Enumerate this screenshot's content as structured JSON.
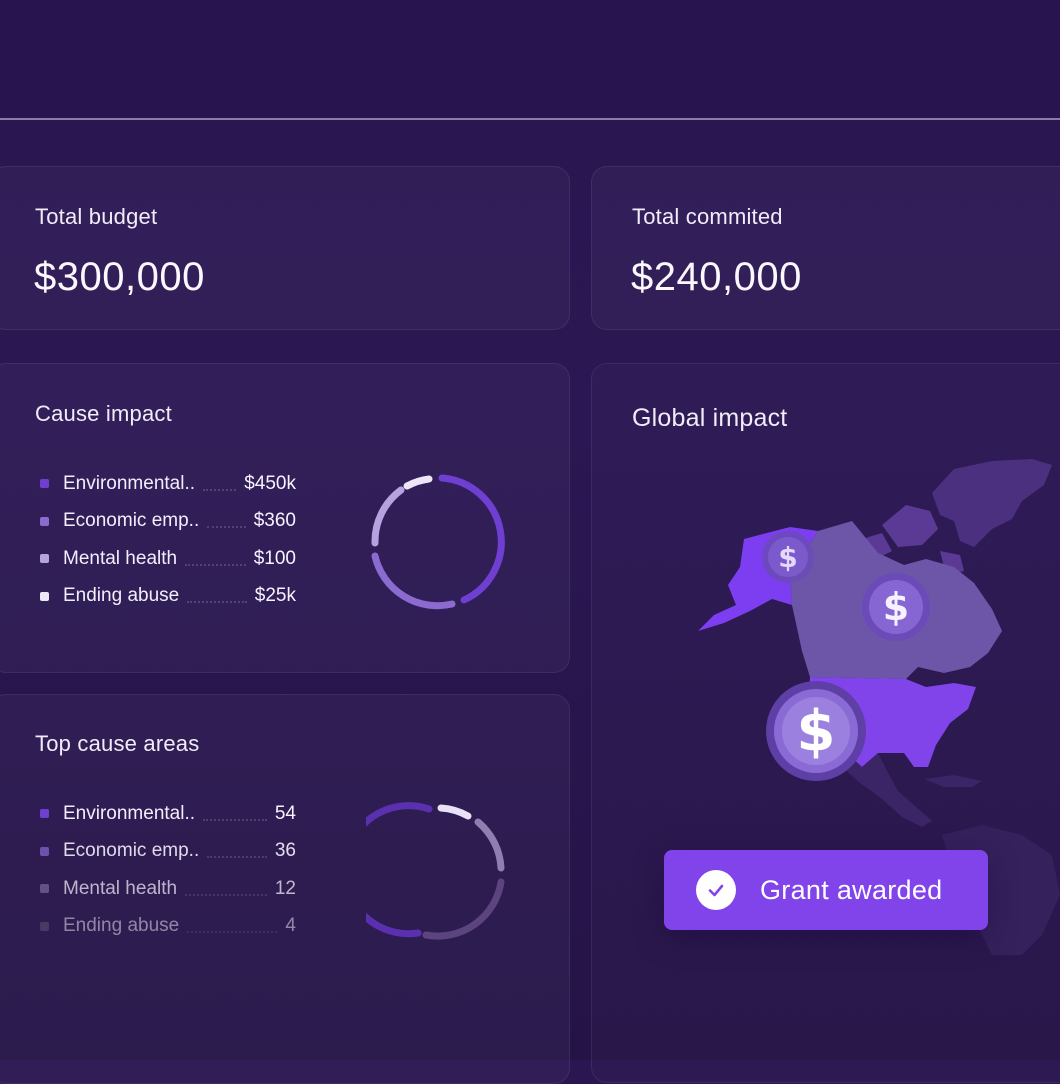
{
  "budget": {
    "title": "Total budget",
    "value": "$300,000"
  },
  "committed": {
    "title": "Total commited",
    "value": "$240,000"
  },
  "cause_impact": {
    "title": "Cause impact",
    "items": [
      {
        "label": "Environmental..",
        "value": "$450k",
        "color": "#6e3fd0"
      },
      {
        "label": "Economic emp..",
        "value": "$360",
        "color": "#8b6bcf"
      },
      {
        "label": "Mental health",
        "value": "$100",
        "color": "#b5a3df"
      },
      {
        "label": "Ending abuse",
        "value": "$25k",
        "color": "#ece6f8"
      }
    ]
  },
  "top_cause_areas": {
    "title": "Top cause areas",
    "items": [
      {
        "label": "Environmental..",
        "value": "54",
        "color": "#6e3fd0"
      },
      {
        "label": "Economic emp..",
        "value": "36",
        "color": "#7556b8"
      },
      {
        "label": "Mental health",
        "value": "12",
        "color": "#7a6898"
      },
      {
        "label": "Ending abuse",
        "value": "4",
        "color": "#655679"
      }
    ]
  },
  "global_impact": {
    "title": "Global impact"
  },
  "grant": {
    "label": "Grant awarded",
    "accent": "#8144ea"
  },
  "icons": {
    "coin": "dollar-coin-icon",
    "check": "check-icon"
  }
}
